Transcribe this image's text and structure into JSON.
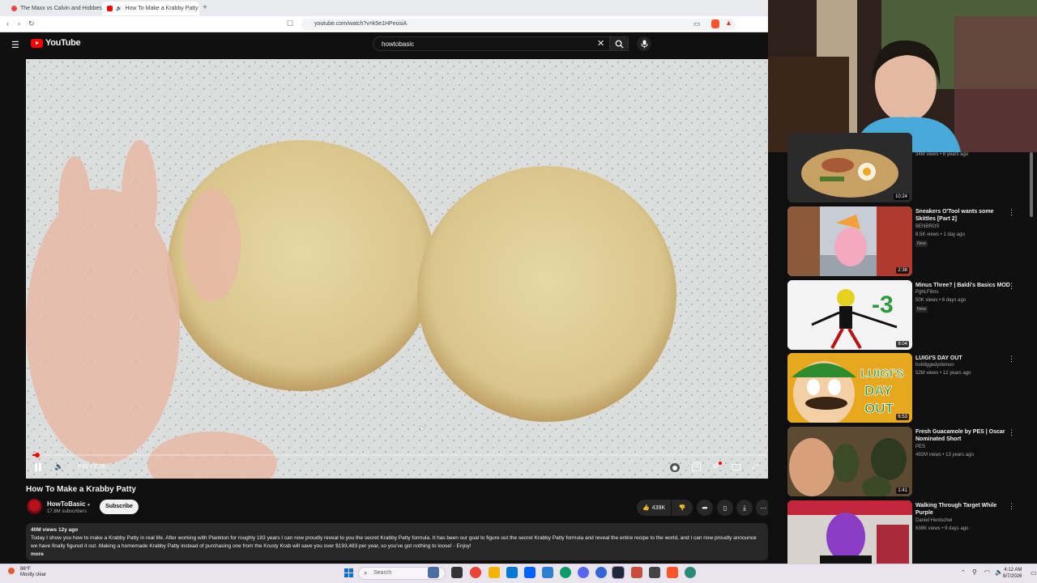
{
  "browser": {
    "tabs": [
      {
        "label": "The Maxx vs Calvin and Hobbes",
        "active": false
      },
      {
        "label": "How To Make a Krabby Patty",
        "active": true
      }
    ],
    "url": "youtube.com/watch?v=k5e1HPeusiA"
  },
  "youtube": {
    "logo_text": "YouTube",
    "search_value": "howtobasic"
  },
  "player": {
    "time": "0:01 / 2:28",
    "progress_fraction": 0.007
  },
  "video": {
    "title": "How To Make a Krabby Patty",
    "channel": "HowToBasic",
    "subscribers": "17.8M subscribers",
    "subscribe_label": "Subscribe",
    "likes": "439K",
    "stats": "40M views  12y ago",
    "description": "Today I show you how to make a Krabby Patty in real life. After working with Plankton for roughly 183 years I can now proudly reveal to you the secret Krabby Patty formula. It has been our goal to figure out the secret Krabby Patty formula and reveal the entire recipe to the world, and I can now proudly announce we have finally figured it out. Making a homemade Krabby Patty instead of purchasing one from the Krusty Krab will save you over $193,483 per year, so you've got nothing to loose! - Enjoy!",
    "more_label": "more"
  },
  "recommendations": [
    {
      "title": "",
      "channel": "",
      "meta": "34M views • 8 years ago",
      "duration": "10:24",
      "new": "",
      "thumb_color": "#2b2b2b"
    },
    {
      "title": "Sneakers O'Tool wants some Skittles [Part 2]",
      "channel": "BENBROS",
      "meta": "8.5K views • 1 day ago",
      "duration": "2:38",
      "new": "New",
      "thumb_color": "#6d7f93"
    },
    {
      "title": "Minus Three? | Baldi's Basics MOD",
      "channel": "PghLFilms",
      "meta": "50K views • 6 days ago",
      "duration": "8:04",
      "new": "New",
      "thumb_color": "#f2f2f2"
    },
    {
      "title": "LUIGI'S DAY OUT",
      "channel": "hotdiggedydemon",
      "meta": "52M views • 12 years ago",
      "duration": "6:53",
      "new": "",
      "thumb_color": "#d49a1e"
    },
    {
      "title": "Fresh Guacamole by PES | Oscar Nominated Short",
      "channel": "PES",
      "meta": "492M views • 13 years ago",
      "duration": "1:41",
      "new": "",
      "thumb_color": "#6e5a3a"
    },
    {
      "title": "Walking Through Target While Purple",
      "channel": "Daniel Hentschel",
      "meta": "638K views • 9 days ago",
      "duration": "",
      "new": "",
      "thumb_color": "#8a2a4a"
    }
  ],
  "taskbar": {
    "weather_temp": "86°F",
    "weather_desc": "Mostly clear",
    "search_placeholder": "Search",
    "time": "4:12 AM",
    "date": "8/7/2026"
  },
  "thumbnail_texts": {
    "minus_three": "-3",
    "luigi": "LUIGI'S DAY OUT"
  }
}
